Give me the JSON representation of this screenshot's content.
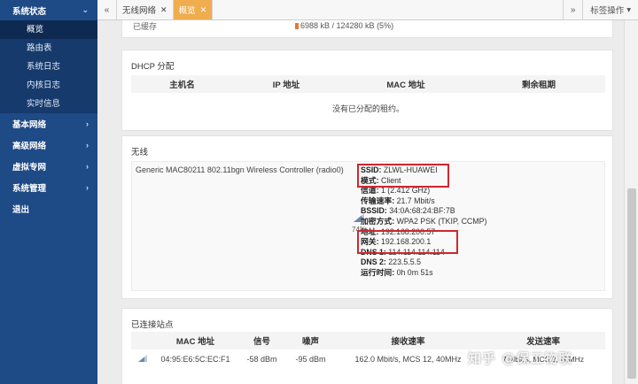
{
  "sidebar": {
    "top": {
      "label": "系统状态"
    },
    "subitems": [
      {
        "label": "概览",
        "active": true
      },
      {
        "label": "路由表"
      },
      {
        "label": "系统日志"
      },
      {
        "label": "内核日志"
      },
      {
        "label": "实时信息"
      }
    ],
    "main": [
      {
        "label": "基本网络"
      },
      {
        "label": "高级网络"
      },
      {
        "label": "虚拟专网"
      },
      {
        "label": "系统管理"
      },
      {
        "label": "退出"
      }
    ]
  },
  "tabs": {
    "items": [
      {
        "label": "无线网络"
      },
      {
        "label": "概览",
        "active": true
      }
    ],
    "ops_label": "标签操作"
  },
  "memory": {
    "label": "已缓存",
    "value": "6988 kB / 124280 kB (5%)"
  },
  "dhcp": {
    "title": "DHCP 分配",
    "columns": [
      "主机名",
      "IP 地址",
      "MAC 地址",
      "剩余租期"
    ],
    "empty": "没有已分配的租约。"
  },
  "wireless": {
    "title": "无线",
    "device": "Generic MAC80211 802.11bgn Wireless Controller (radio0)",
    "signal_pct": "74%",
    "fields": [
      {
        "key": "SSID:",
        "value": " ZLWL-HUAWEI"
      },
      {
        "key": "模式:",
        "value": " Client"
      },
      {
        "key": "信道:",
        "value": " 1 (2.412 GHz)"
      },
      {
        "key": "传输速率:",
        "value": " 21.7 Mbit/s"
      },
      {
        "key": "BSSID:",
        "value": " 34:0A:68:24:BF:7B"
      },
      {
        "key": "加密方式:",
        "value": " WPA2 PSK (TKIP, CCMP)"
      },
      {
        "key": "地址:",
        "value": " 192.168.200.57"
      },
      {
        "key": "网关:",
        "value": " 192.168.200.1"
      },
      {
        "key": "DNS 1:",
        "value": " 114.114.114.114"
      },
      {
        "key": "DNS 2:",
        "value": " 223.5.5.5"
      },
      {
        "key": "运行时间:",
        "value": " 0h 0m 51s"
      }
    ]
  },
  "stations": {
    "title": "已连接站点",
    "columns": [
      "MAC 地址",
      "信号",
      "噪声",
      "接收速率",
      "发送速率"
    ],
    "rows": [
      {
        "mac": "04:95:E6:5C:EC:F1",
        "signal": "-58 dBm",
        "noise": "-95 dBm",
        "rx": "162.0 Mbit/s, MCS 12, 40MHz",
        "tx": "7 Mbit/s, MCS 2, 40MHz"
      }
    ]
  },
  "watermark": "知乎 @保工物联",
  "colors": {
    "sidebar": "#1e4a86",
    "active_tab": "#f0ad4e",
    "highlight": "#d0262c"
  }
}
